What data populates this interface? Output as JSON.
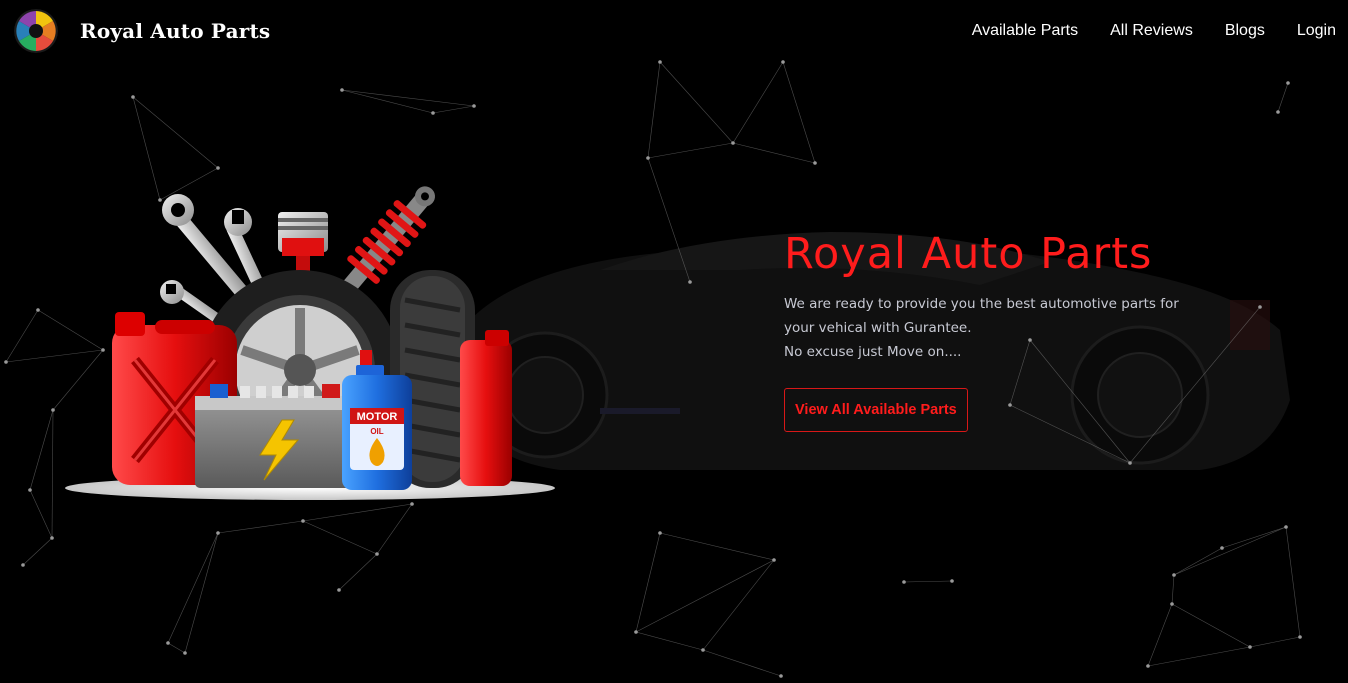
{
  "navbar": {
    "brand": "Royal Auto Parts",
    "links": [
      "Available Parts",
      "All Reviews",
      "Blogs",
      "Login"
    ]
  },
  "hero": {
    "title": "Royal Auto Parts",
    "description_lines": [
      "We are ready to provide you the best automotive parts for",
      "your vehical with Gurantee.",
      "No excuse just Move on...."
    ],
    "cta_label": "View All Available Parts",
    "battery_label": "MOTOR",
    "oil_label": "OIL"
  },
  "colors": {
    "background": "#000000",
    "accent": "#ff1c1c",
    "text": "#ffffff",
    "muted_text": "#c7c9d3"
  },
  "icons": [
    "brand-logo-icon",
    "wrench-icon",
    "piston-icon",
    "shock-absorber-icon",
    "jerrycan-icon",
    "tire-icon",
    "battery-icon",
    "motor-oil-icon",
    "lightning-icon"
  ]
}
